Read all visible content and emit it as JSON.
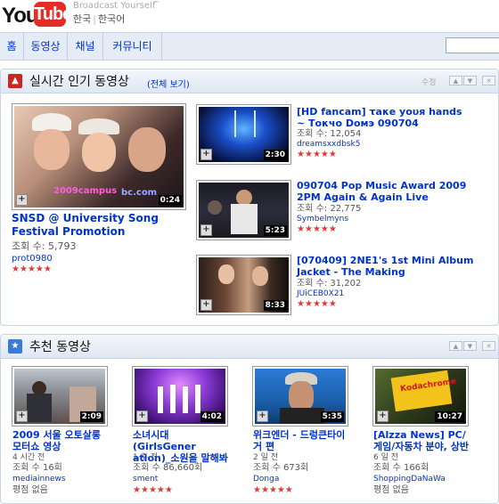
{
  "header": {
    "logo_you": "You",
    "logo_tube": "Tube",
    "tagline": "Broadcast Yourself",
    "tm": "™",
    "lang_primary": "한국",
    "lang_secondary": "한국어"
  },
  "nav": {
    "items": [
      {
        "label": "홈"
      },
      {
        "label": "동영상"
      },
      {
        "label": "채널"
      },
      {
        "label": "커뮤니티"
      }
    ],
    "search_value": ""
  },
  "popular": {
    "title": "실시간 인기 동영상",
    "see_all": "(전체 보기)",
    "edit": "수정",
    "featured": {
      "title": "SNSD @ University Song Festival Promotion",
      "views": "조회 수: 5,793",
      "user": "prot0980",
      "duration": "0:24",
      "rating": 5,
      "overlay_text": "2009campus",
      "overlay_text2": "bc.com"
    },
    "items": [
      {
        "title": "[HD fancam] τaκe уουя hands ~ Τοκчο Dοмэ 090704",
        "views": "조회 수: 12,054",
        "user": "dreamsxxdbsk5",
        "duration": "2:30",
        "rating": 5
      },
      {
        "title": "090704 Pop Music Award 2009 2PM Again & Again Live",
        "views": "조회 수: 22,775",
        "user": "Symbelmyns",
        "duration": "5:23",
        "rating": 5
      },
      {
        "title": "[070409] 2NE1's 1st Mini Album Jacket - The Making",
        "views": "조회 수: 31,202",
        "user": "JUiCEB0X21",
        "duration": "8:33",
        "rating": 5
      }
    ]
  },
  "recommended": {
    "title": "추천 동영상",
    "items": [
      {
        "title": "2009 서울 오토살롱 모터쇼 영상",
        "time": "4 시간 전",
        "views": "조회 수 16회",
        "user": "mediainnews",
        "rating_text": "평점 없음",
        "duration": "2:09",
        "rating": 0
      },
      {
        "title": "소녀시대(GirlsGener ation)_소원을 말해봐",
        "time": "1 주 전",
        "views": "조회 수 86,660회",
        "user": "sment",
        "rating_text": "",
        "duration": "4:02",
        "rating": 4.5
      },
      {
        "title": "위크엔더 - 드렁큰타이거 편",
        "time": "2 일 전",
        "views": "조회 수 673회",
        "user": "Donga",
        "rating_text": "",
        "duration": "5:35",
        "rating": 5
      },
      {
        "title": "[Alzza News] PC/게임/자동차 분야, 상반",
        "time": "6 일 전",
        "views": "조회 수 166회",
        "user": "ShoppingDaNaWa",
        "rating_text": "평점 없음",
        "duration": "10:27",
        "rating": 0,
        "overlay_text": "Kodachrome"
      }
    ]
  },
  "icons": [
    "plus-icon",
    "arrow-up-icon",
    "arrow-down-icon",
    "close-icon",
    "star-icon",
    "popular-icon",
    "recommend-icon"
  ],
  "colors": {
    "brand_red": "#e52d27",
    "link_blue": "#0033cc",
    "star_red": "#e0393b",
    "nav_bg": "#e6ecf5"
  }
}
